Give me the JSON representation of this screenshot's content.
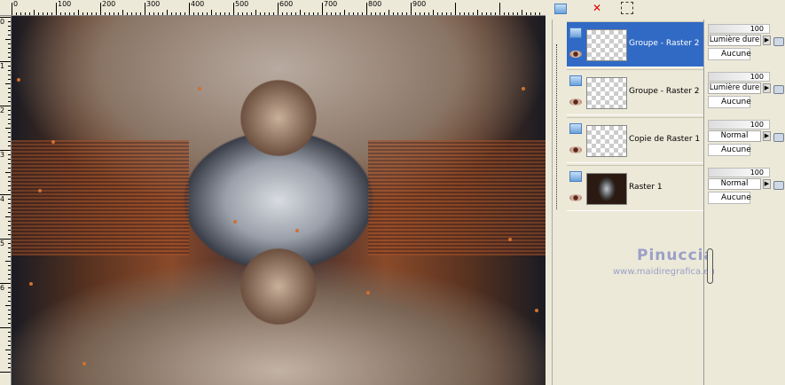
{
  "ruler": {
    "h_labels": [
      "0",
      "100",
      "200",
      "300",
      "400",
      "500",
      "600",
      "700",
      "800",
      "900"
    ],
    "v_labels": [
      "0",
      "1",
      "2",
      "3",
      "4",
      "5",
      "6"
    ]
  },
  "toolbar": {
    "icons": [
      "new-layer-icon",
      "delete-layer-icon",
      "edit-selection-icon"
    ]
  },
  "layers": [
    {
      "name": "Groupe - Raster 2",
      "selected": true,
      "opacity": "100",
      "blend": "Lumière dure",
      "mask": "Aucune"
    },
    {
      "name": "Groupe - Raster 2",
      "selected": false,
      "opacity": "100",
      "blend": "Lumière dure",
      "mask": "Aucune"
    },
    {
      "name": "Copie de Raster 1",
      "selected": false,
      "opacity": "100",
      "blend": "Normal",
      "mask": "Aucune"
    },
    {
      "name": "Raster 1",
      "selected": false,
      "opacity": "100",
      "blend": "Normal",
      "mask": "Aucune"
    }
  ],
  "watermark": {
    "name": "Pinuccia",
    "url": "www.maidiregrafica.eu"
  },
  "colors": {
    "selection": "#316ac5",
    "panel": "#ece9d8"
  }
}
